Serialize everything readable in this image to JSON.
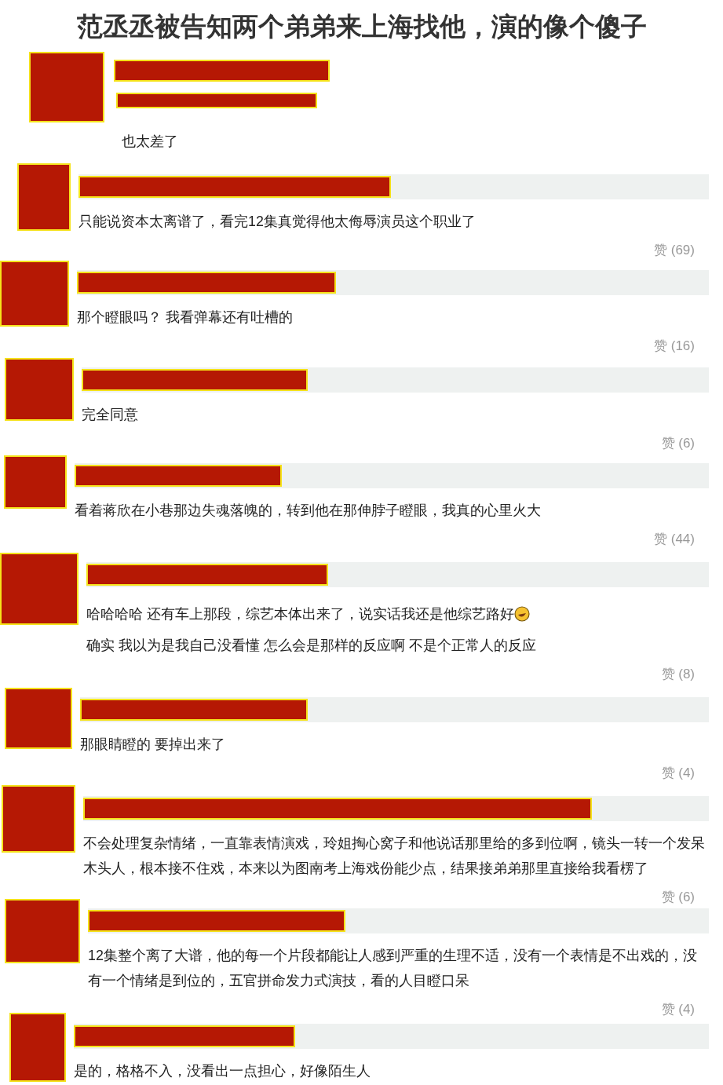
{
  "title": "范丞丞被告知两个弟弟来上海找他，演的像个傻子",
  "post": {
    "text": "也太差了"
  },
  "comments": [
    {
      "paragraphs": [
        "只能说资本太离谱了，看完12集真觉得他太侮辱演员这个职业了"
      ],
      "likes": "赞 (69)"
    },
    {
      "paragraphs": [
        "那个瞪眼吗？ 我看弹幕还有吐槽的"
      ],
      "likes": "赞 (16)"
    },
    {
      "paragraphs": [
        "完全同意"
      ],
      "likes": "赞 (6)"
    },
    {
      "paragraphs": [
        "看着蒋欣在小巷那边失魂落魄的，转到他在那伸脖子瞪眼，我真的心里火大"
      ],
      "likes": "赞 (44)"
    },
    {
      "paragraphs": [
        "哈哈哈哈 还有车上那段，综艺本体出来了，说实话我还是他综艺路好",
        "确实 我以为是我自己没看懂 怎么会是那样的反应啊 不是个正常人的反应"
      ],
      "emoji_after_first": true,
      "likes": "赞 (8)"
    },
    {
      "paragraphs": [
        "那眼睛瞪的 要掉出来了"
      ],
      "likes": "赞 (4)"
    },
    {
      "paragraphs": [
        "不会处理复杂情绪，一直靠表情演戏，玲姐掏心窝子和他说话那里给的多到位啊，镜头一转一个发呆木头人，根本接不住戏，本来以为图南考上海戏份能少点，结果接弟弟那里直接给我看楞了"
      ],
      "likes": "赞 (6)"
    },
    {
      "paragraphs": [
        "12集整个离了大谱，他的每一个片段都能让人感到严重的生理不适，没有一个表情是不出戏的，没有一个情绪是到位的，五官拼命发力式演技，看的人目瞪口呆"
      ],
      "likes": "赞 (4)"
    },
    {
      "paragraphs": [
        "是的，格格不入，没看出一点担心，好像陌生人"
      ]
    }
  ]
}
